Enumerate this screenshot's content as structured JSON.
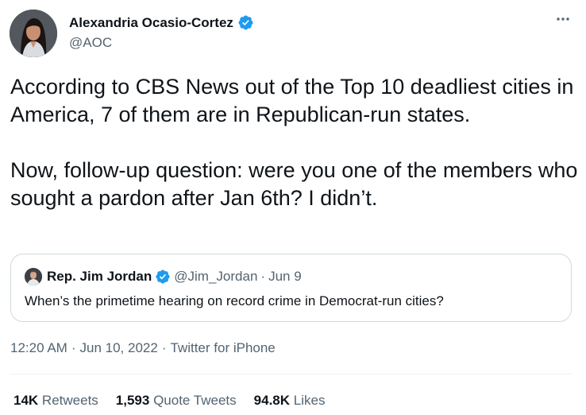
{
  "author": {
    "name": "Alexandria Ocasio-Cortez",
    "handle": "@AOC",
    "verified": true,
    "avatar_icon": "profile-photo"
  },
  "tweet": {
    "text": "According to CBS News out of the Top 10 deadliest cities in America, 7 of them are in Republican-run states.\n\nNow, follow-up question: were you one of the members who sought a pardon after Jan 6th? I didn’t."
  },
  "quote": {
    "name": "Rep. Jim Jordan",
    "handle": "@Jim_Jordan",
    "separator": "·",
    "date": "Jun 9",
    "text": "When’s the primetime hearing on record crime in Democrat-run cities?",
    "verified": true
  },
  "meta": {
    "time": "12:20 AM",
    "separator": "·",
    "date": "Jun 10, 2022",
    "separator2": "·",
    "source": "Twitter for iPhone"
  },
  "stats": {
    "retweets_count": "14K",
    "retweets_label": "Retweets",
    "quotes_count": "1,593",
    "quotes_label": "Quote Tweets",
    "likes_count": "94.8K",
    "likes_label": "Likes"
  },
  "colors": {
    "verified": "#1d9bf0",
    "text_primary": "#0f1419",
    "text_secondary": "#536471",
    "border": "#cfd9de"
  }
}
